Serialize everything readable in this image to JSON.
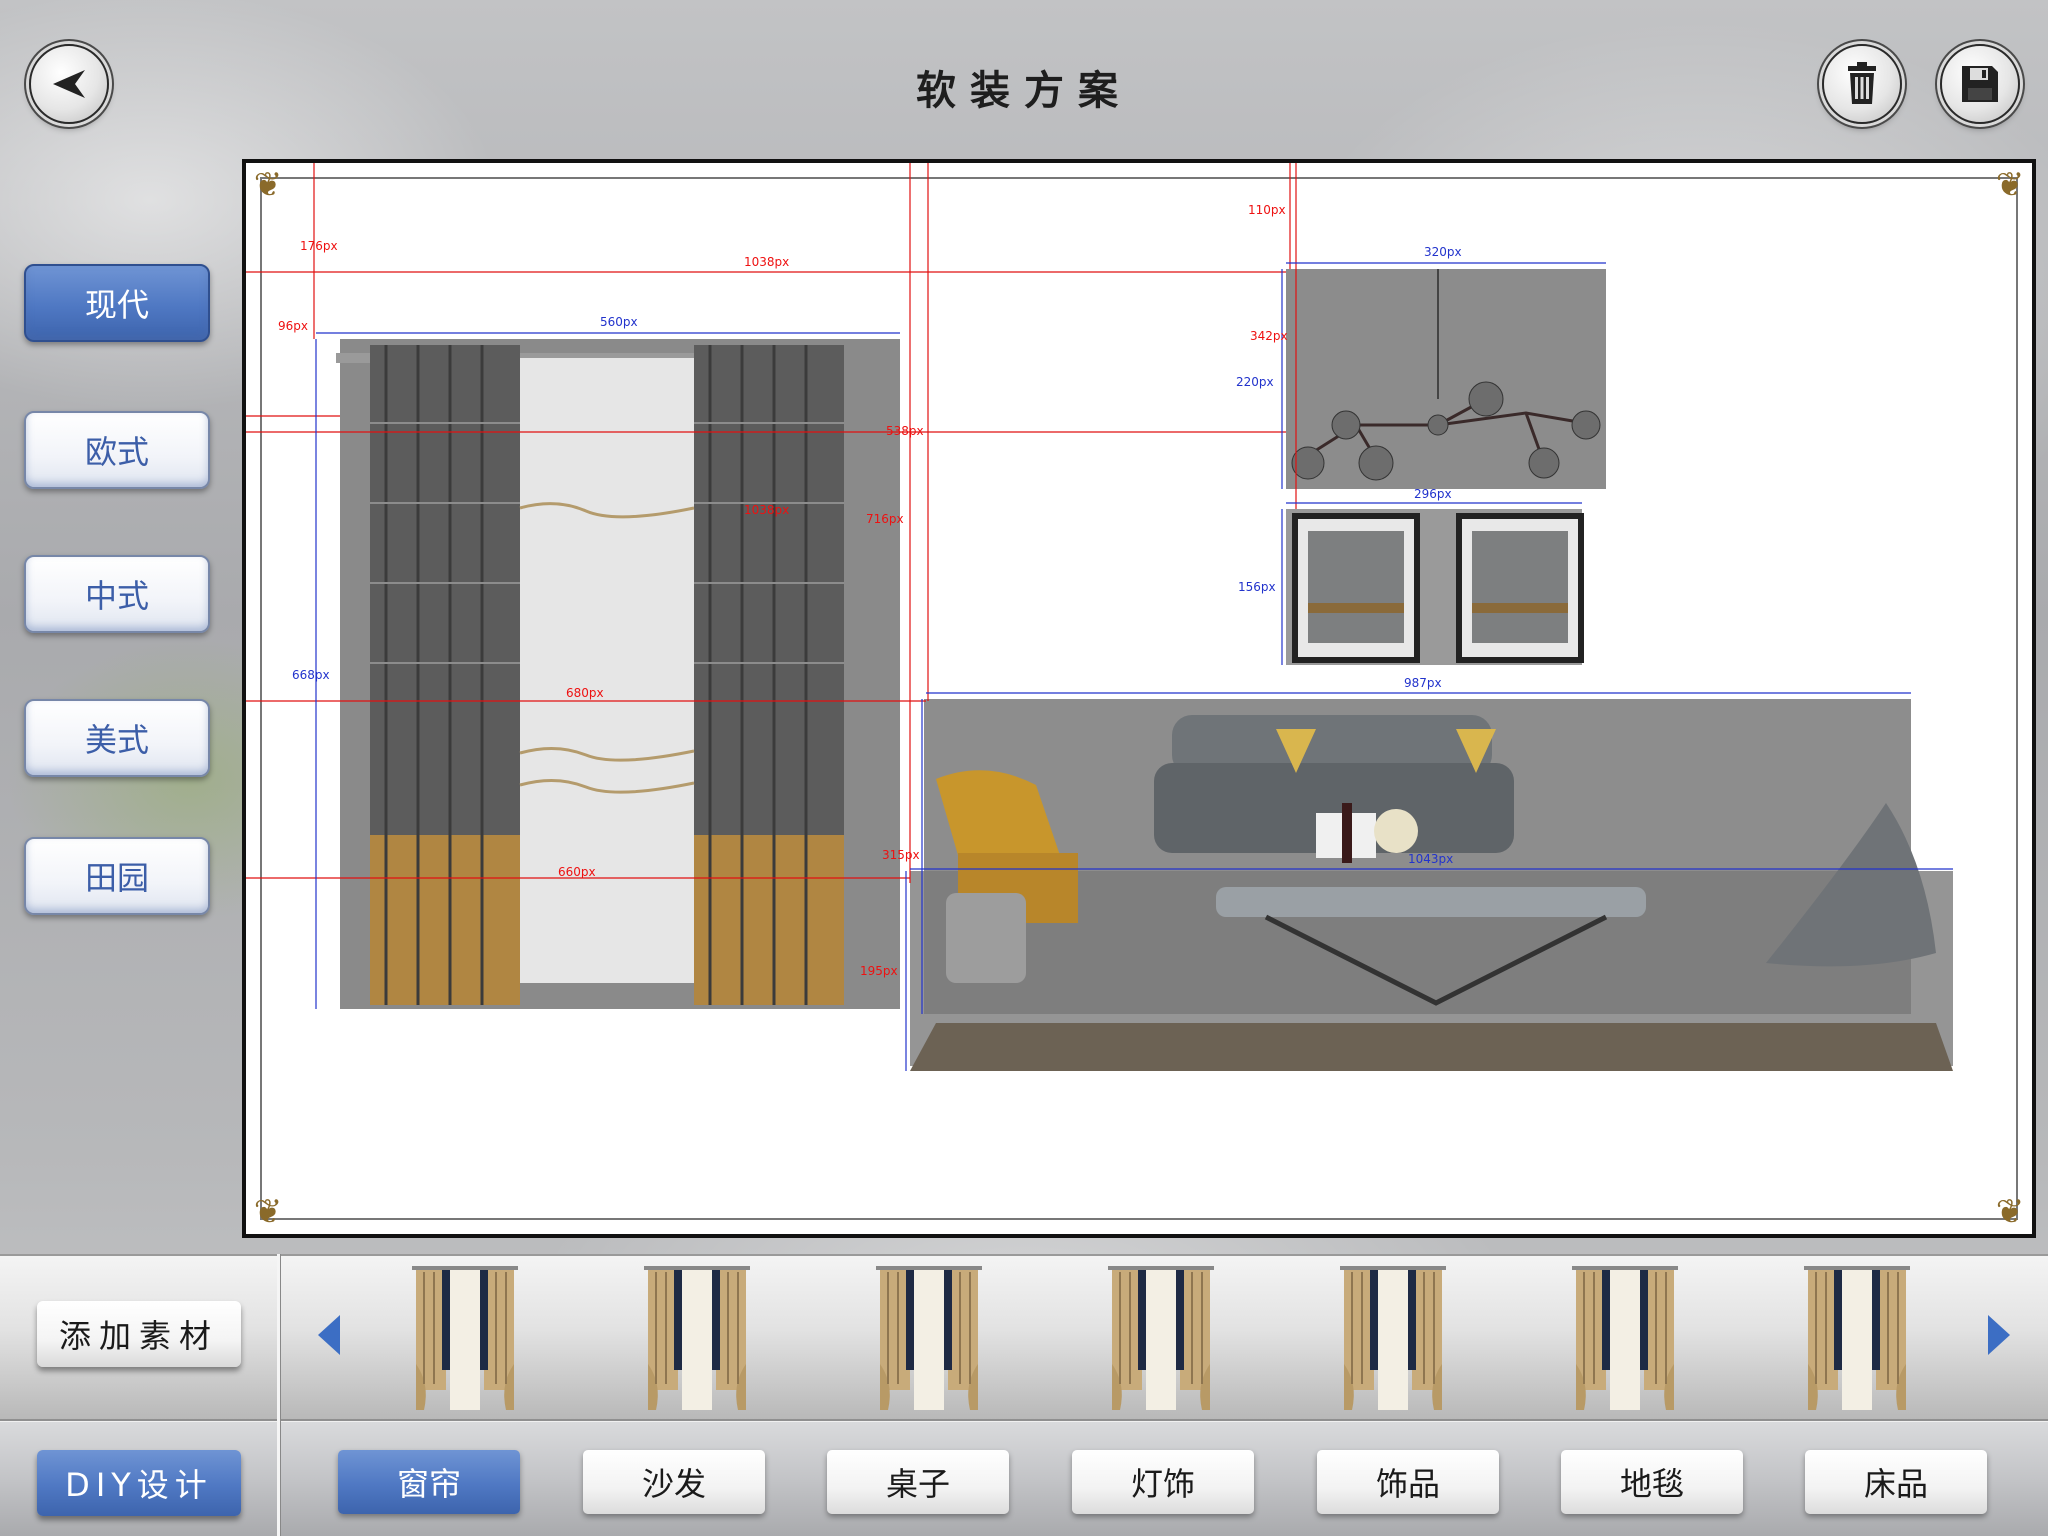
{
  "header": {
    "title": "软装方案"
  },
  "styles": [
    {
      "label": "现代",
      "active": true
    },
    {
      "label": "欧式",
      "active": false
    },
    {
      "label": "中式",
      "active": false
    },
    {
      "label": "美式",
      "active": false
    },
    {
      "label": "田园",
      "active": false
    }
  ],
  "canvas": {
    "measurements_red": [
      "176px",
      "1038px",
      "96px",
      "110px",
      "342px",
      "538px",
      "1038px",
      "716px",
      "680px",
      "660px",
      "315px",
      "195px"
    ],
    "measurements_blue": [
      "560px",
      "320px",
      "220px",
      "296px",
      "156px",
      "987px",
      "1043px",
      "668px"
    ]
  },
  "toolbar": {
    "add_material_label": "添加素材",
    "diy_label": "DIY设计"
  },
  "thumbnails": {
    "count": 7,
    "item_name": "curtain-thumbnail"
  },
  "categories": [
    {
      "label": "窗帘",
      "active": true
    },
    {
      "label": "沙发",
      "active": false
    },
    {
      "label": "桌子",
      "active": false
    },
    {
      "label": "灯饰",
      "active": false
    },
    {
      "label": "饰品",
      "active": false
    },
    {
      "label": "地毯",
      "active": false
    },
    {
      "label": "床品",
      "active": false
    }
  ],
  "colors": {
    "accent": "#4f78c3",
    "measure_red": "#e11111",
    "measure_blue": "#2233cc"
  }
}
